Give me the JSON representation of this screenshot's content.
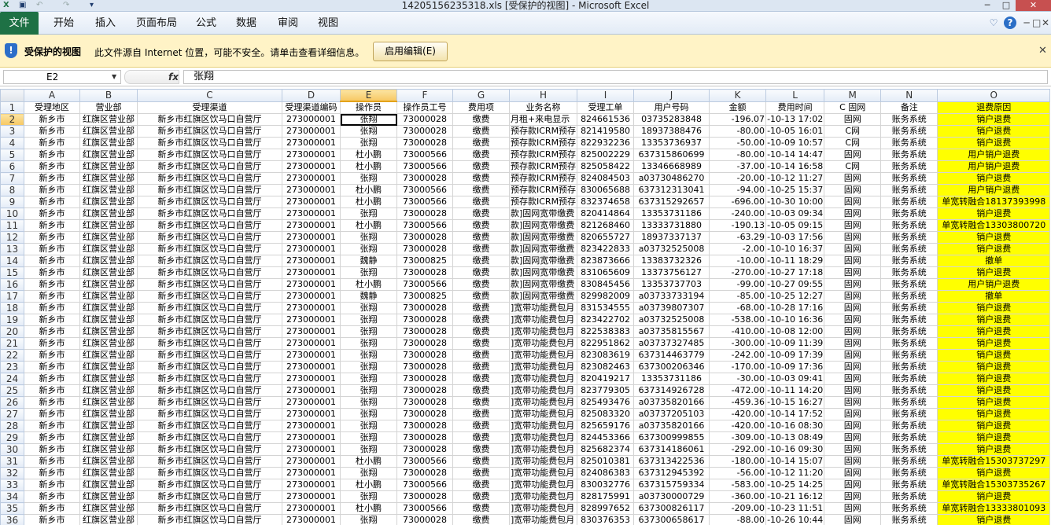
{
  "window": {
    "title": "14205156235318.xls  [受保护的视图]  -  Microsoft Excel",
    "quick_access": [
      "▣",
      "↶",
      "↷",
      "▾"
    ],
    "controls": [
      "─",
      "□",
      "✕"
    ]
  },
  "ribbon": {
    "tabs": [
      "文件",
      "开始",
      "插入",
      "页面布局",
      "公式",
      "数据",
      "审阅",
      "视图"
    ],
    "right_icons": [
      "♡",
      "?",
      "─",
      "□",
      "✕"
    ]
  },
  "protected_view": {
    "title": "受保护的视图",
    "message": "此文件源自 Internet 位置，可能不安全。请单击查看详细信息。",
    "button": "启用编辑(E)",
    "close": "✕"
  },
  "formula_bar": {
    "name_box": "E2",
    "fx": "fx",
    "value": "张翔"
  },
  "columns": [
    "A",
    "B",
    "C",
    "D",
    "E",
    "F",
    "G",
    "H",
    "I",
    "J",
    "K",
    "L",
    "M",
    "N",
    "O"
  ],
  "headers": [
    "受理地区",
    "营业部",
    "受理渠道",
    "受理渠道编码",
    "操作员",
    "操作员工号",
    "费用项",
    "业务名称",
    "受理工单",
    "用户号码",
    "金额",
    "费用时间",
    "C 固网",
    "备注",
    "退费原因"
  ],
  "rows": [
    [
      "新乡市",
      "红旗区营业部",
      "新乡市红旗区饮马口自营厅",
      "273000001",
      "张翔",
      "73000028",
      "缴费",
      "月租+来电显示",
      "824661536",
      "03735283848",
      "-196.07",
      "-10-13 17:02",
      "固网",
      "账务系统",
      "销户退费"
    ],
    [
      "新乡市",
      "红旗区营业部",
      "新乡市红旗区饮马口自营厅",
      "273000001",
      "张翔",
      "73000028",
      "缴费",
      "预存款ICRM预存",
      "821419580",
      "18937388476",
      "-80.00",
      "-10-05 16:01",
      "C网",
      "账务系统",
      "销户退费"
    ],
    [
      "新乡市",
      "红旗区营业部",
      "新乡市红旗区饮马口自营厅",
      "273000001",
      "张翔",
      "73000028",
      "缴费",
      "预存款ICRM预存",
      "822932236",
      "13353736937",
      "-50.00",
      "-10-09 10:57",
      "C网",
      "账务系统",
      "销户退费"
    ],
    [
      "新乡市",
      "红旗区营业部",
      "新乡市红旗区饮马口自营厅",
      "273000001",
      "杜小鹏",
      "73000566",
      "缴费",
      "预存款ICRM预存",
      "825002229",
      "637315860699",
      "-80.00",
      "-10-14 14:47",
      "固网",
      "账务系统",
      "用户销户退费"
    ],
    [
      "新乡市",
      "红旗区营业部",
      "新乡市红旗区饮马口自营厅",
      "273000001",
      "杜小鹏",
      "73000566",
      "缴费",
      "预存款ICRM预存",
      "825058422",
      "13346668989",
      "-37.00",
      "-10-14 16:58",
      "C网",
      "账务系统",
      "用户销户退费"
    ],
    [
      "新乡市",
      "红旗区营业部",
      "新乡市红旗区饮马口自营厅",
      "273000001",
      "张翔",
      "73000028",
      "缴费",
      "预存款ICRM预存",
      "824084503",
      "a03730486270",
      "-20.00",
      "-10-12 11:27",
      "固网",
      "账务系统",
      "销户退费"
    ],
    [
      "新乡市",
      "红旗区营业部",
      "新乡市红旗区饮马口自营厅",
      "273000001",
      "杜小鹏",
      "73000566",
      "缴费",
      "预存款ICRM预存",
      "830065688",
      "637312313041",
      "-94.00",
      "-10-25 15:37",
      "固网",
      "账务系统",
      "用户销户退费"
    ],
    [
      "新乡市",
      "红旗区营业部",
      "新乡市红旗区饮马口自营厅",
      "273000001",
      "杜小鹏",
      "73000566",
      "缴费",
      "预存款ICRM预存",
      "832374658",
      "637315292657",
      "-696.00",
      "-10-30 10:00",
      "固网",
      "账务系统",
      "单宽转融合18137393998"
    ],
    [
      "新乡市",
      "红旗区营业部",
      "新乡市红旗区饮马口自营厅",
      "273000001",
      "张翔",
      "73000028",
      "缴费",
      "款]固网宽带缴费",
      "820414864",
      "13353731186",
      "-240.00",
      "-10-03 09:34",
      "固网",
      "账务系统",
      "销户退费"
    ],
    [
      "新乡市",
      "红旗区营业部",
      "新乡市红旗区饮马口自营厅",
      "273000001",
      "杜小鹏",
      "73000566",
      "缴费",
      "款]固网宽带缴费",
      "821268460",
      "13333731880",
      "-190.13",
      "-10-05 09:15",
      "固网",
      "账务系统",
      "单宽转融合13303800720"
    ],
    [
      "新乡市",
      "红旗区营业部",
      "新乡市红旗区饮马口自营厅",
      "273000001",
      "张翔",
      "73000028",
      "缴费",
      "款]固网宽带缴费",
      "820655727",
      "18937337137",
      "-63.29",
      "-10-03 17:56",
      "固网",
      "账务系统",
      "销户退费"
    ],
    [
      "新乡市",
      "红旗区营业部",
      "新乡市红旗区饮马口自营厅",
      "273000001",
      "张翔",
      "73000028",
      "缴费",
      "款]固网宽带缴费",
      "823422833",
      "a03732525008",
      "-2.00",
      "-10-10 16:37",
      "固网",
      "账务系统",
      "销户退费"
    ],
    [
      "新乡市",
      "红旗区营业部",
      "新乡市红旗区饮马口自营厅",
      "273000001",
      "魏静",
      "73000825",
      "缴费",
      "款]固网宽带缴费",
      "823873666",
      "13383732326",
      "-10.00",
      "-10-11 18:29",
      "固网",
      "账务系统",
      "撤单"
    ],
    [
      "新乡市",
      "红旗区营业部",
      "新乡市红旗区饮马口自营厅",
      "273000001",
      "张翔",
      "73000028",
      "缴费",
      "款]固网宽带缴费",
      "831065609",
      "13373756127",
      "-270.00",
      "-10-27 17:18",
      "固网",
      "账务系统",
      "销户退费"
    ],
    [
      "新乡市",
      "红旗区营业部",
      "新乡市红旗区饮马口自营厅",
      "273000001",
      "杜小鹏",
      "73000566",
      "缴费",
      "款]固网宽带缴费",
      "830845456",
      "13353737703",
      "-99.00",
      "-10-27 09:55",
      "固网",
      "账务系统",
      "用户销户退费"
    ],
    [
      "新乡市",
      "红旗区营业部",
      "新乡市红旗区饮马口自营厅",
      "273000001",
      "魏静",
      "73000825",
      "缴费",
      "款]固网宽带缴费",
      "829982009",
      "a03733733194",
      "-85.00",
      "-10-25 12:27",
      "固网",
      "账务系统",
      "撤单"
    ],
    [
      "新乡市",
      "红旗区营业部",
      "新乡市红旗区饮马口自营厅",
      "273000001",
      "张翔",
      "73000028",
      "缴费",
      "]宽带功能费包月",
      "831534555",
      "a03739807307",
      "-68.00",
      "-10-28 17:16",
      "固网",
      "账务系统",
      "销户退费"
    ],
    [
      "新乡市",
      "红旗区营业部",
      "新乡市红旗区饮马口自营厅",
      "273000001",
      "张翔",
      "73000028",
      "缴费",
      "]宽带功能费包月",
      "823422702",
      "a03732525008",
      "-538.00",
      "-10-10 16:36",
      "固网",
      "账务系统",
      "销户退费"
    ],
    [
      "新乡市",
      "红旗区营业部",
      "新乡市红旗区饮马口自营厅",
      "273000001",
      "张翔",
      "73000028",
      "缴费",
      "]宽带功能费包月",
      "822538383",
      "a03735815567",
      "-410.00",
      "-10-08 12:00",
      "固网",
      "账务系统",
      "销户退费"
    ],
    [
      "新乡市",
      "红旗区营业部",
      "新乡市红旗区饮马口自营厅",
      "273000001",
      "张翔",
      "73000028",
      "缴费",
      "]宽带功能费包月",
      "822951862",
      "a03737327485",
      "-300.00",
      "-10-09 11:39",
      "固网",
      "账务系统",
      "销户退费"
    ],
    [
      "新乡市",
      "红旗区营业部",
      "新乡市红旗区饮马口自营厅",
      "273000001",
      "张翔",
      "73000028",
      "缴费",
      "]宽带功能费包月",
      "823083619",
      "637314463779",
      "-242.00",
      "-10-09 17:39",
      "固网",
      "账务系统",
      "销户退费"
    ],
    [
      "新乡市",
      "红旗区营业部",
      "新乡市红旗区饮马口自营厅",
      "273000001",
      "张翔",
      "73000028",
      "缴费",
      "]宽带功能费包月",
      "823082463",
      "637300206346",
      "-170.00",
      "-10-09 17:36",
      "固网",
      "账务系统",
      "销户退费"
    ],
    [
      "新乡市",
      "红旗区营业部",
      "新乡市红旗区饮马口自营厅",
      "273000001",
      "张翔",
      "73000028",
      "缴费",
      "]宽带功能费包月",
      "820419217",
      "13353731186",
      "-30.00",
      "-10-03 09:41",
      "固网",
      "账务系统",
      "销户退费"
    ],
    [
      "新乡市",
      "红旗区营业部",
      "新乡市红旗区饮马口自营厅",
      "273000001",
      "张翔",
      "73000028",
      "缴费",
      "]宽带功能费包月",
      "823779305",
      "637314926728",
      "-472.00",
      "-10-11 14:20",
      "固网",
      "账务系统",
      "销户退费"
    ],
    [
      "新乡市",
      "红旗区营业部",
      "新乡市红旗区饮马口自营厅",
      "273000001",
      "张翔",
      "73000028",
      "缴费",
      "]宽带功能费包月",
      "825493476",
      "a03735820166",
      "-459.36",
      "-10-15 16:27",
      "固网",
      "账务系统",
      "销户退费"
    ],
    [
      "新乡市",
      "红旗区营业部",
      "新乡市红旗区饮马口自营厅",
      "273000001",
      "张翔",
      "73000028",
      "缴费",
      "]宽带功能费包月",
      "825083320",
      "a03737205103",
      "-420.00",
      "-10-14 17:52",
      "固网",
      "账务系统",
      "销户退费"
    ],
    [
      "新乡市",
      "红旗区营业部",
      "新乡市红旗区饮马口自营厅",
      "273000001",
      "张翔",
      "73000028",
      "缴费",
      "]宽带功能费包月",
      "825659176",
      "a03735820166",
      "-420.00",
      "-10-16 08:30",
      "固网",
      "账务系统",
      "销户退费"
    ],
    [
      "新乡市",
      "红旗区营业部",
      "新乡市红旗区饮马口自营厅",
      "273000001",
      "张翔",
      "73000028",
      "缴费",
      "]宽带功能费包月",
      "824453366",
      "637300999855",
      "-309.00",
      "-10-13 08:49",
      "固网",
      "账务系统",
      "销户退费"
    ],
    [
      "新乡市",
      "红旗区营业部",
      "新乡市红旗区饮马口自营厅",
      "273000001",
      "张翔",
      "73000028",
      "缴费",
      "]宽带功能费包月",
      "825682374",
      "637314186061",
      "-292.00",
      "-10-16 09:30",
      "固网",
      "账务系统",
      "销户退费"
    ],
    [
      "新乡市",
      "红旗区营业部",
      "新乡市红旗区饮马口自营厅",
      "273000001",
      "杜小鹏",
      "73000566",
      "缴费",
      "]宽带功能费包月",
      "825010381",
      "637313422536",
      "-180.00",
      "-10-14 15:07",
      "固网",
      "账务系统",
      "单宽转融合15303737297"
    ],
    [
      "新乡市",
      "红旗区营业部",
      "新乡市红旗区饮马口自营厅",
      "273000001",
      "张翔",
      "73000028",
      "缴费",
      "]宽带功能费包月",
      "824086383",
      "637312945392",
      "-56.00",
      "-10-12 11:20",
      "固网",
      "账务系统",
      "销户退费"
    ],
    [
      "新乡市",
      "红旗区营业部",
      "新乡市红旗区饮马口自营厅",
      "273000001",
      "杜小鹏",
      "73000566",
      "缴费",
      "]宽带功能费包月",
      "830032776",
      "637315759334",
      "-583.00",
      "-10-25 14:25",
      "固网",
      "账务系统",
      "单宽转融合15303735267"
    ],
    [
      "新乡市",
      "红旗区营业部",
      "新乡市红旗区饮马口自营厅",
      "273000001",
      "张翔",
      "73000028",
      "缴费",
      "]宽带功能费包月",
      "828175991",
      "a03730000729",
      "-360.00",
      "-10-21 16:12",
      "固网",
      "账务系统",
      "销户退费"
    ],
    [
      "新乡市",
      "红旗区营业部",
      "新乡市红旗区饮马口自营厅",
      "273000001",
      "杜小鹏",
      "73000566",
      "缴费",
      "]宽带功能费包月",
      "828997652",
      "637300826117",
      "-209.00",
      "-10-23 11:51",
      "固网",
      "账务系统",
      "单宽转融合13333801093"
    ],
    [
      "新乡市",
      "红旗区营业部",
      "新乡市红旗区饮马口自营厅",
      "273000001",
      "张翔",
      "73000028",
      "缴费",
      "]宽带功能费包月",
      "830376353",
      "637300658617",
      "-88.00",
      "-10-26 10:44",
      "固网",
      "账务系统",
      "销户退费"
    ]
  ]
}
